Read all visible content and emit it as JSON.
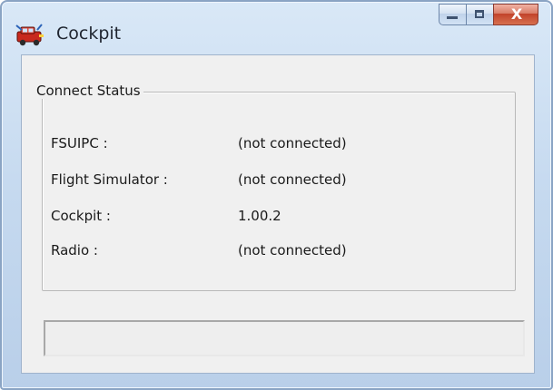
{
  "window": {
    "title": "Cockpit",
    "app_icon": "cockpit-app-icon",
    "accent": "#8aa4c4"
  },
  "caption_buttons": {
    "minimize_icon": "minimize-icon",
    "maximize_icon": "maximize-icon",
    "close_glyph": "X"
  },
  "group": {
    "legend": "Connect Status",
    "rows": [
      {
        "label": "FSUIPC :",
        "value": "(not connected)"
      },
      {
        "label": "Flight Simulator :",
        "value": "(not connected)"
      },
      {
        "label": "Cockpit :",
        "value": "1.00.2"
      },
      {
        "label": "Radio :",
        "value": "(not connected)"
      }
    ]
  },
  "status_field": {
    "text": ""
  }
}
